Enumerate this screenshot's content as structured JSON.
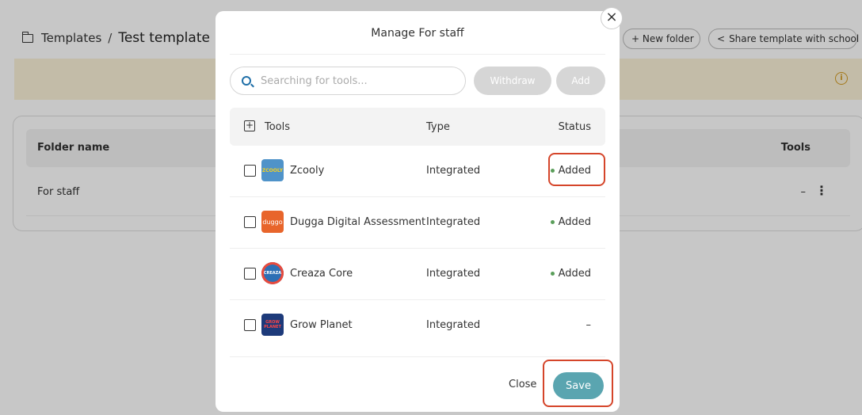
{
  "breadcrumb": {
    "root": "Templates",
    "separator": "/",
    "current": "Test template"
  },
  "header_buttons": {
    "new_folder": "+ New folder",
    "share": "Share template with school"
  },
  "table": {
    "col_folder": "Folder name",
    "col_tools": "Tools",
    "rows": [
      {
        "name": "For staff",
        "tools": "–"
      }
    ]
  },
  "modal": {
    "title": "Manage For staff",
    "search_placeholder": "Searching for tools...",
    "withdraw_label": "Withdraw",
    "add_label": "Add",
    "columns": {
      "tools": "Tools",
      "type": "Type",
      "status": "Status"
    },
    "rows": [
      {
        "name": "Zcooly",
        "logo_text": "ZCOOLY",
        "logo_color": "#4f93c9",
        "type": "Integrated",
        "status": "Added"
      },
      {
        "name": "Dugga Digital Assessment",
        "logo_text": "duggo",
        "logo_color": "#e8652b",
        "type": "Integrated",
        "status": "Added"
      },
      {
        "name": "Creaza Core",
        "logo_text": "CREAZA",
        "logo_color": "#2d6fb5",
        "type": "Integrated",
        "status": "Added"
      },
      {
        "name": "Grow Planet",
        "logo_text": "GROW PLANET",
        "logo_color": "#1d3a7a",
        "type": "Integrated",
        "status": "–"
      }
    ],
    "close_label": "Close",
    "save_label": "Save"
  },
  "colors": {
    "accent": "#5aa5b0",
    "highlight": "#d5452a",
    "banner": "#faf1d8",
    "added_dot": "#5a9e5a"
  },
  "icons": {
    "close": "close-icon",
    "search": "search-icon",
    "info": "info-icon",
    "share": "share-icon",
    "folder": "folder-icon"
  }
}
